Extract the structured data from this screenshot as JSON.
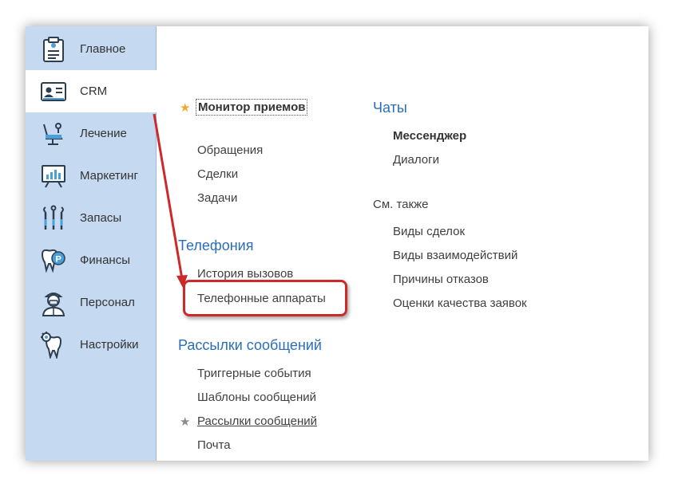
{
  "sidebar": {
    "items": [
      {
        "label": "Главное",
        "icon": "clipboard-icon"
      },
      {
        "label": "CRM",
        "icon": "id-card-icon"
      },
      {
        "label": "Лечение",
        "icon": "dental-chair-icon"
      },
      {
        "label": "Маркетинг",
        "icon": "chart-board-icon"
      },
      {
        "label": "Запасы",
        "icon": "dental-tools-icon"
      },
      {
        "label": "Финансы",
        "icon": "tooth-coin-icon"
      },
      {
        "label": "Персонал",
        "icon": "doctor-icon"
      },
      {
        "label": "Настройки",
        "icon": "tooth-gear-icon"
      }
    ],
    "active": "CRM"
  },
  "main": {
    "favorite": "Монитор приемов",
    "links": [
      "Обращения",
      "Сделки",
      "Задачи"
    ],
    "telephony": {
      "title": "Телефония",
      "items": [
        "История вызовов",
        "Телефонные аппараты"
      ]
    },
    "mailing": {
      "title": "Рассылки сообщений",
      "items": [
        "Триггерные события",
        "Шаблоны сообщений",
        "Рассылки сообщений",
        "Почта"
      ]
    },
    "chats": {
      "title": "Чаты",
      "items": [
        "Мессенджер",
        "Диалоги"
      ]
    },
    "see_also": {
      "title": "См. также",
      "items": [
        "Виды сделок",
        "Виды взаимодействий",
        "Причины отказов",
        "Оценки качества заявок"
      ]
    }
  },
  "colors": {
    "sidebar_bg": "#c5d9f1",
    "section_title": "#2a6ebb",
    "highlight": "#cc2a2a",
    "arrow": "#cc2a2a",
    "star_active": "#f0a830",
    "star_inactive": "#8a8a8a"
  }
}
